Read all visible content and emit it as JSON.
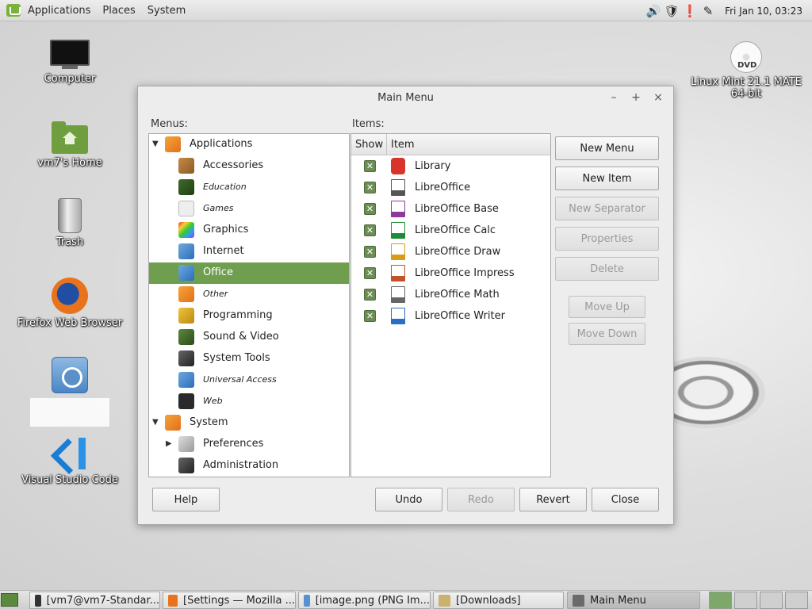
{
  "top_panel": {
    "menus": [
      "Applications",
      "Places",
      "System"
    ],
    "clock": "Fri Jan 10, 03:23"
  },
  "desktop": {
    "icons": [
      {
        "label": "Computer"
      },
      {
        "label": "vm7's Home"
      },
      {
        "label": "Trash"
      },
      {
        "label": "Firefox Web Browser"
      },
      {
        "label": ""
      },
      {
        "label": "Visual Studio Code"
      },
      {
        "label": "Linux Mint 21.1 MATE 64-bit"
      }
    ],
    "dvd_text": "DVD"
  },
  "dialog": {
    "title": "Main Menu",
    "wm_buttons": [
      "–",
      "+",
      "×"
    ],
    "menus_label": "Menus:",
    "items_label": "Items:",
    "menus_tree": [
      {
        "label": "Applications",
        "level": 0,
        "expander": "▼",
        "icon": "applications-icon",
        "italic": false,
        "selected": false
      },
      {
        "label": "Accessories",
        "level": 1,
        "expander": "",
        "icon": "accessories-icon",
        "italic": false,
        "selected": false
      },
      {
        "label": "Education",
        "level": 1,
        "expander": "",
        "icon": "education-icon",
        "italic": true,
        "selected": false
      },
      {
        "label": "Games",
        "level": 1,
        "expander": "",
        "icon": "games-icon",
        "italic": true,
        "selected": false
      },
      {
        "label": "Graphics",
        "level": 1,
        "expander": "",
        "icon": "graphics-icon",
        "italic": false,
        "selected": false
      },
      {
        "label": "Internet",
        "level": 1,
        "expander": "",
        "icon": "internet-icon",
        "italic": false,
        "selected": false
      },
      {
        "label": "Office",
        "level": 1,
        "expander": "",
        "icon": "office-icon",
        "italic": false,
        "selected": true
      },
      {
        "label": "Other",
        "level": 1,
        "expander": "",
        "icon": "other-icon",
        "italic": true,
        "selected": false
      },
      {
        "label": "Programming",
        "level": 1,
        "expander": "",
        "icon": "programming-icon",
        "italic": false,
        "selected": false
      },
      {
        "label": "Sound & Video",
        "level": 1,
        "expander": "",
        "icon": "sound-video-icon",
        "italic": false,
        "selected": false
      },
      {
        "label": "System Tools",
        "level": 1,
        "expander": "",
        "icon": "system-tools-icon",
        "italic": false,
        "selected": false
      },
      {
        "label": "Universal Access",
        "level": 1,
        "expander": "",
        "icon": "universal-access-icon",
        "italic": true,
        "selected": false
      },
      {
        "label": "Web",
        "level": 1,
        "expander": "",
        "icon": "web-icon",
        "italic": true,
        "selected": false
      },
      {
        "label": "System",
        "level": 0,
        "expander": "▼",
        "icon": "system-icon",
        "italic": false,
        "selected": false
      },
      {
        "label": "Preferences",
        "level": 1,
        "expander": "▶",
        "icon": "preferences-icon",
        "italic": false,
        "selected": false
      },
      {
        "label": "Administration",
        "level": 1,
        "expander": "",
        "icon": "administration-icon",
        "italic": false,
        "selected": false
      }
    ],
    "items_columns": {
      "show": "Show",
      "item": "Item"
    },
    "items": [
      {
        "label": "Library",
        "shown": true,
        "icon": "library-icon",
        "color": "#d9342b"
      },
      {
        "label": "LibreOffice",
        "shown": true,
        "icon": "libreoffice-icon",
        "color": "#555555"
      },
      {
        "label": "LibreOffice Base",
        "shown": true,
        "icon": "libreoffice-base-icon",
        "color": "#8e3a9c"
      },
      {
        "label": "LibreOffice Calc",
        "shown": true,
        "icon": "libreoffice-calc-icon",
        "color": "#1f8b3a"
      },
      {
        "label": "LibreOffice Draw",
        "shown": true,
        "icon": "libreoffice-draw-icon",
        "color": "#d89b1a"
      },
      {
        "label": "LibreOffice Impress",
        "shown": true,
        "icon": "libreoffice-impress-icon",
        "color": "#c2542a"
      },
      {
        "label": "LibreOffice Math",
        "shown": true,
        "icon": "libreoffice-math-icon",
        "color": "#666666"
      },
      {
        "label": "LibreOffice Writer",
        "shown": true,
        "icon": "libreoffice-writer-icon",
        "color": "#2a6fc2"
      }
    ],
    "side_buttons": {
      "new_menu": "New Menu",
      "new_item": "New Item",
      "new_separator": "New Separator",
      "properties": "Properties",
      "delete": "Delete",
      "move_up": "Move Up",
      "move_down": "Move Down"
    },
    "bottom_buttons": {
      "help": "Help",
      "undo": "Undo",
      "redo": "Redo",
      "revert": "Revert",
      "close": "Close"
    }
  },
  "taskbar": {
    "tasks": [
      {
        "label": "[vm7@vm7-Standar...",
        "active": false,
        "icon": "terminal-icon"
      },
      {
        "label": "[Settings — Mozilla ...",
        "active": false,
        "icon": "firefox-icon"
      },
      {
        "label": "[image.png (PNG Im...",
        "active": false,
        "icon": "image-viewer-icon"
      },
      {
        "label": "[Downloads]",
        "active": false,
        "icon": "folder-icon"
      },
      {
        "label": "Main Menu",
        "active": true,
        "icon": "menu-editor-icon"
      }
    ],
    "workspaces": 4,
    "active_workspace": 1
  },
  "colors": {
    "selection": "#6f9e4f",
    "check": "#6b8e54",
    "accent": "#7ab33a"
  }
}
